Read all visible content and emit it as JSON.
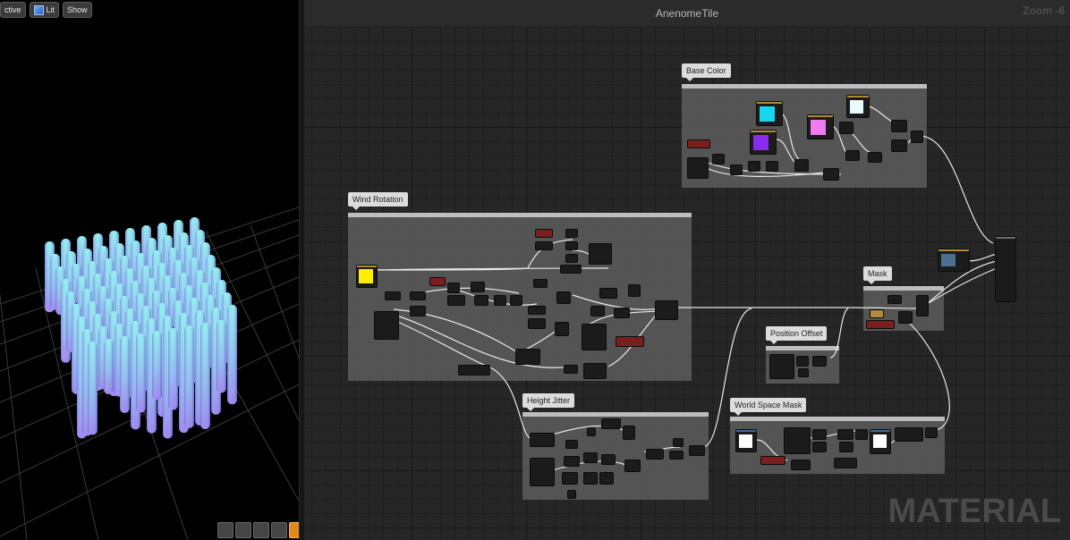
{
  "viewport": {
    "toolbar": {
      "perspective_label": "ctive",
      "lit_label": "Lit",
      "show_label": "Show"
    },
    "bottom_icons": [
      "view-icon",
      "sphere-icon",
      "plane-icon",
      "cube-icon",
      "teapot-icon"
    ]
  },
  "graph": {
    "title": "AnenomeTile",
    "zoom": "Zoom -6",
    "watermark": "MATERIAL"
  },
  "comments": [
    {
      "id": "base-color",
      "title": "Base Color"
    },
    {
      "id": "wind-rotation",
      "title": "Wind Rotation"
    },
    {
      "id": "mask",
      "title": "Mask"
    },
    {
      "id": "position-offset",
      "title": "Position Offset"
    },
    {
      "id": "height-jitter",
      "title": "Height Jitter"
    },
    {
      "id": "world-space-mask",
      "title": "World Space Mask"
    }
  ],
  "swatch_colors": {
    "cyan": "#19d6f0",
    "violet": "#8b2bf0",
    "pink": "#f07cf0",
    "lightcyan": "#e8fbff",
    "yellow": "#ffee00",
    "white": "#ffffff"
  }
}
